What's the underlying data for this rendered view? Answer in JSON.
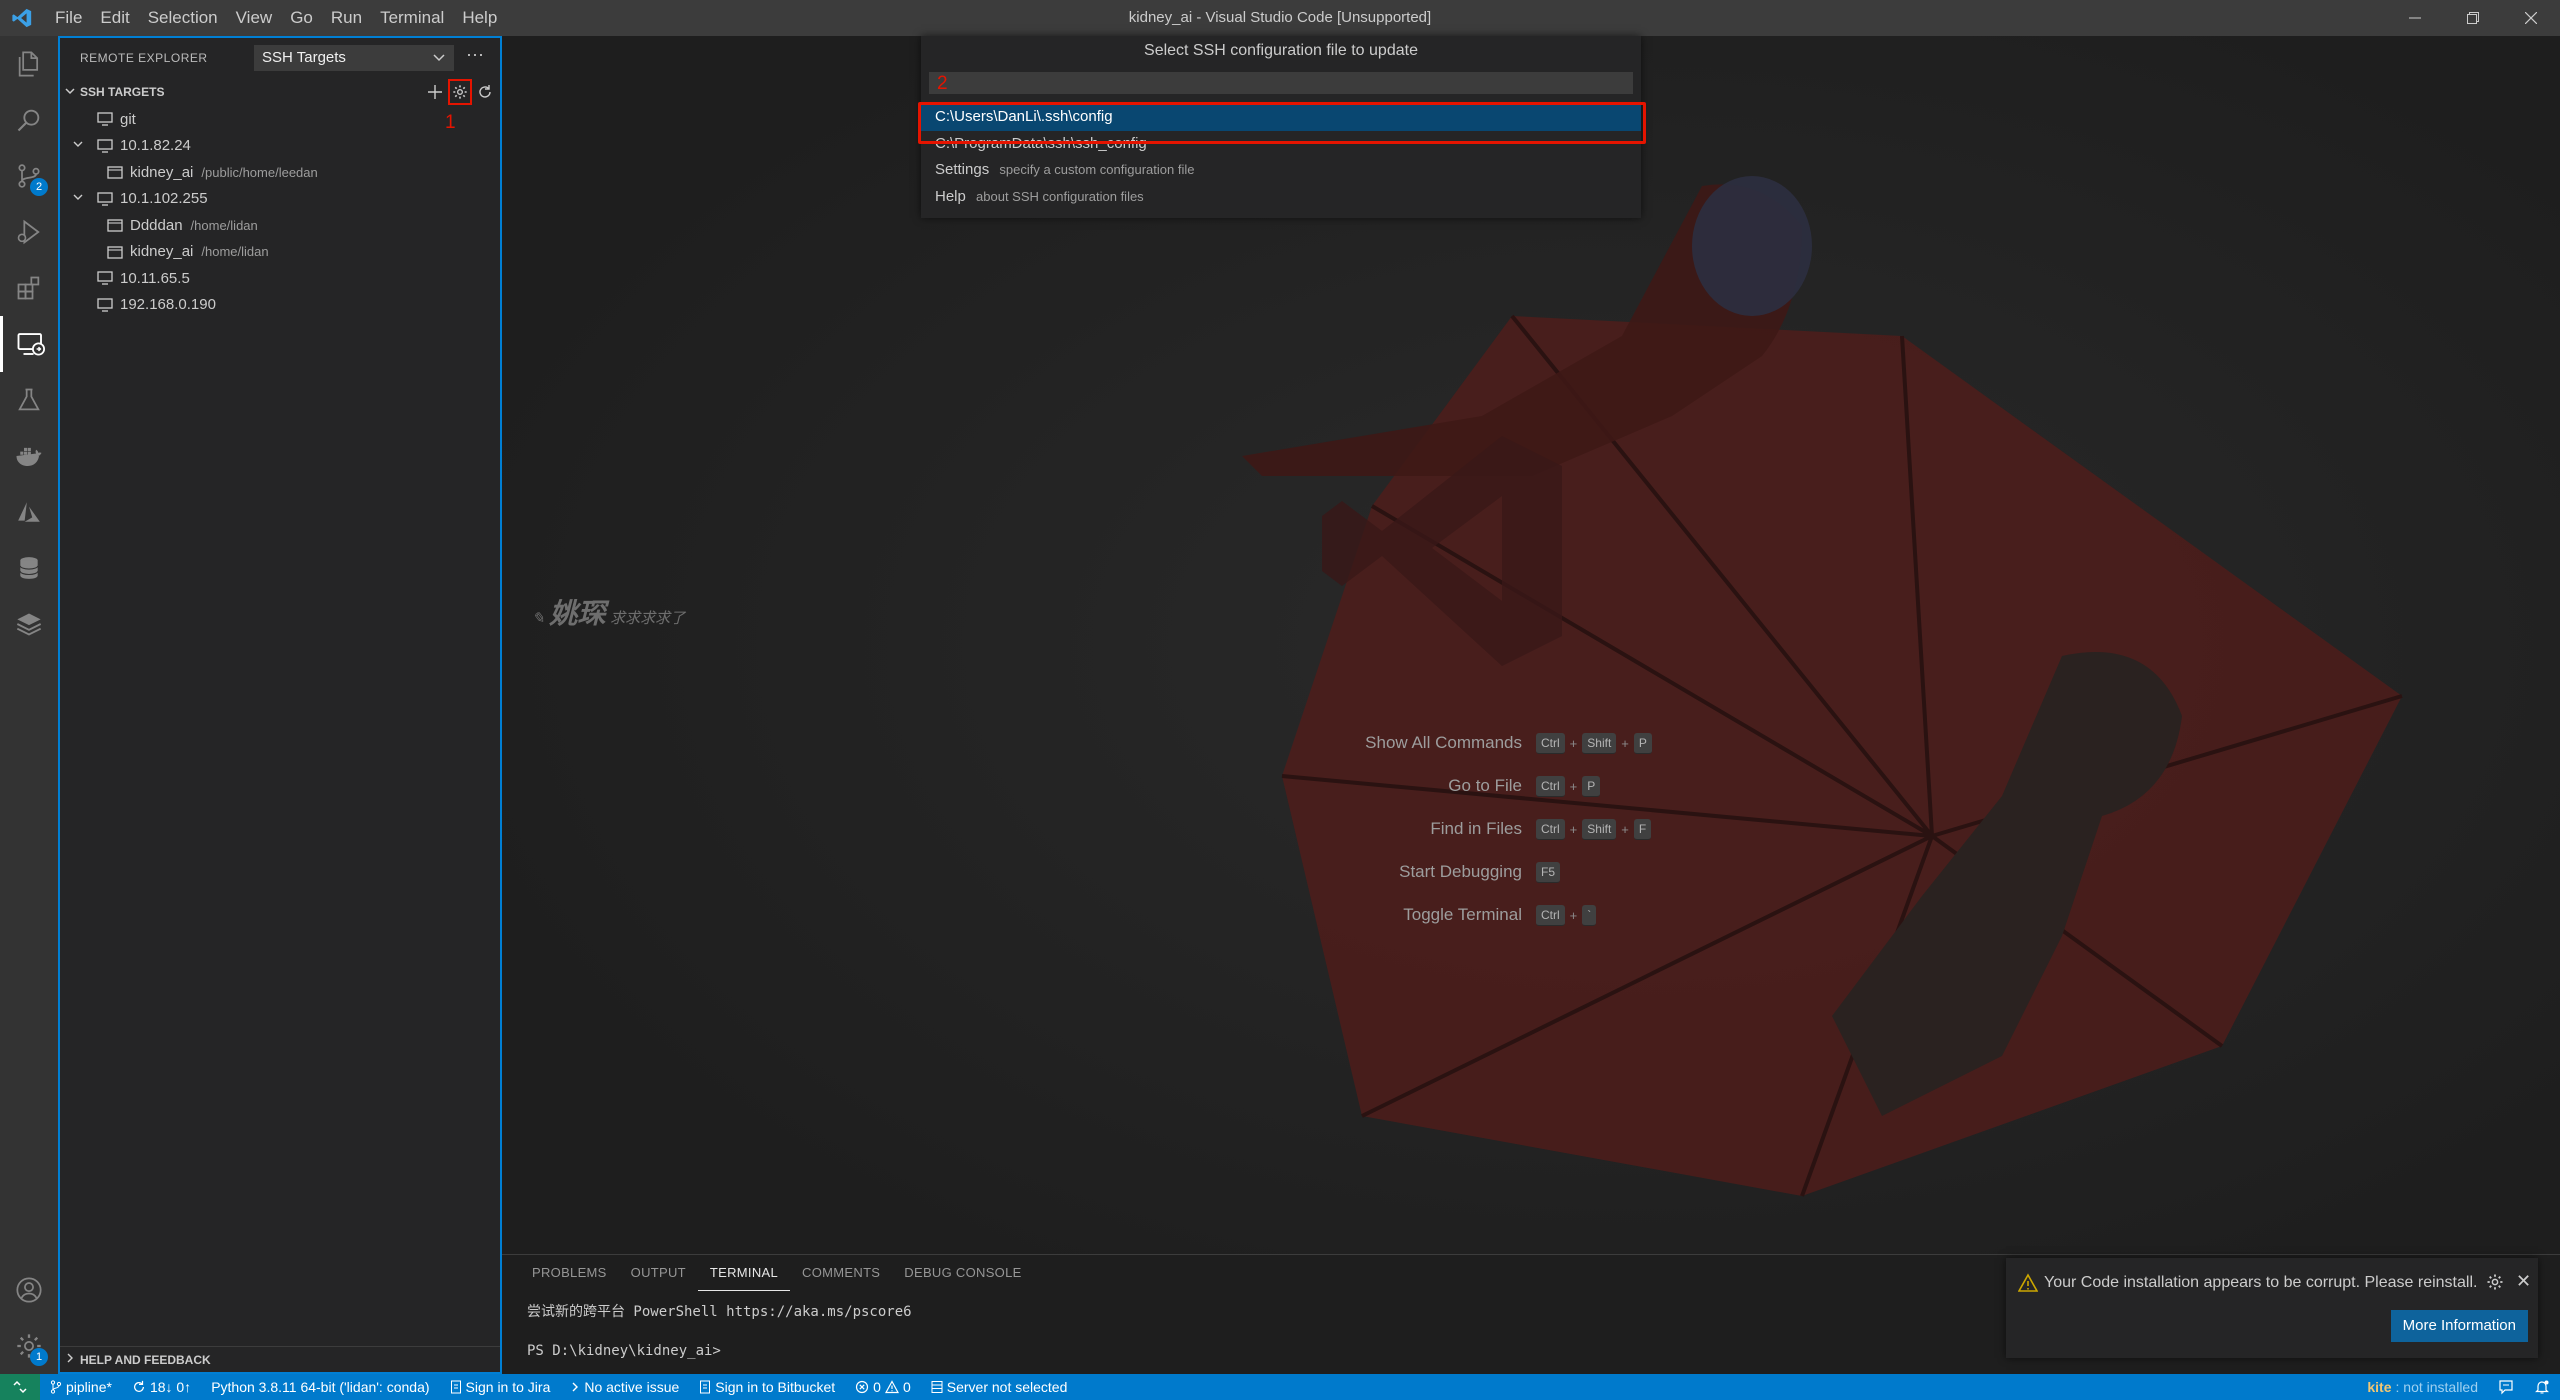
{
  "window": {
    "title": "kidney_ai - Visual Studio Code [Unsupported]",
    "menu": [
      "File",
      "Edit",
      "Selection",
      "View",
      "Go",
      "Run",
      "Terminal",
      "Help"
    ]
  },
  "activity_bar": {
    "source_control_badge": "2",
    "manage_badge": "1"
  },
  "sidebar": {
    "header": "REMOTE EXPLORER",
    "dropdown_value": "SSH Targets",
    "section_title": "SSH TARGETS",
    "annotation_1": "1",
    "tree": [
      {
        "label": "git",
        "desc": ""
      },
      {
        "label": "10.1.82.24",
        "desc": ""
      },
      {
        "label": "kidney_ai",
        "desc": "/public/home/leedan"
      },
      {
        "label": "10.1.102.255",
        "desc": ""
      },
      {
        "label": "Ddddan",
        "desc": "/home/lidan"
      },
      {
        "label": "kidney_ai",
        "desc": "/home/lidan"
      },
      {
        "label": "10.11.65.5",
        "desc": ""
      },
      {
        "label": "192.168.0.190",
        "desc": ""
      }
    ],
    "help_feedback": "HELP AND FEEDBACK"
  },
  "quick_pick": {
    "title": "Select SSH configuration file to update",
    "annotation_2": "2",
    "items": [
      {
        "label": "C:\\Users\\DanLi\\.ssh\\config",
        "desc": ""
      },
      {
        "label": "C:\\ProgramData\\ssh\\ssh_config",
        "desc": ""
      },
      {
        "label": "Settings",
        "desc": "specify a custom configuration file"
      },
      {
        "label": "Help",
        "desc": "about SSH configuration files"
      }
    ]
  },
  "editor": {
    "signature": "姚琛",
    "signature_tail": "求求求求了",
    "shortcuts": [
      {
        "label": "Show All Commands",
        "keys": [
          "Ctrl",
          "Shift",
          "P"
        ]
      },
      {
        "label": "Go to File",
        "keys": [
          "Ctrl",
          "P"
        ]
      },
      {
        "label": "Find in Files",
        "keys": [
          "Ctrl",
          "Shift",
          "F"
        ]
      },
      {
        "label": "Start Debugging",
        "keys": [
          "F5"
        ]
      },
      {
        "label": "Toggle Terminal",
        "keys": [
          "Ctrl",
          "`"
        ]
      }
    ]
  },
  "panel": {
    "tabs": [
      "PROBLEMS",
      "OUTPUT",
      "TERMINAL",
      "COMMENTS",
      "DEBUG CONSOLE"
    ],
    "active_tab": "TERMINAL",
    "terminal_line1": "尝试新的跨平台 PowerShell https://aka.ms/pscore6",
    "terminal_line2": "PS D:\\kidney\\kidney_ai>"
  },
  "notification": {
    "message": "Your Code installation appears to be corrupt. Please reinstall.",
    "button": "More Information"
  },
  "statusbar": {
    "branch": "pipline*",
    "sync": "18↓ 0↑",
    "python": "Python 3.8.11 64-bit ('lidan': conda)",
    "jira": "Sign in to Jira",
    "issue": "No active issue",
    "bitbucket": "Sign in to Bitbucket",
    "errors": "0",
    "warnings": "0",
    "server": "Server not selected",
    "kite_name": "kite",
    "kite_status": ": not installed"
  },
  "colors": {
    "accent": "#007acc",
    "annotation": "#e51400",
    "selection": "#094771"
  }
}
